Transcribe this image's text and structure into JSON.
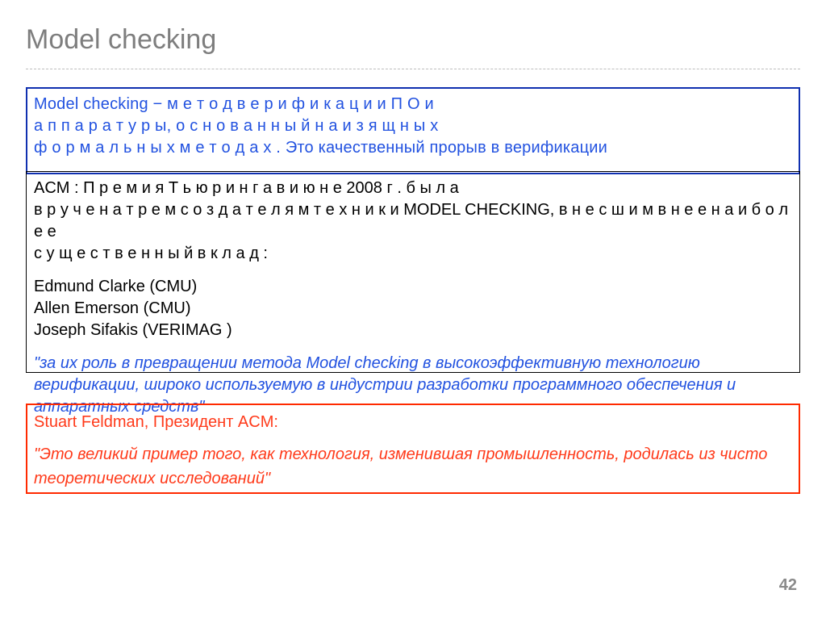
{
  "title": "Model checking",
  "blue_box": {
    "lead": "Model checking",
    "dash": " − ",
    "line1": "м е т о д  в е р и ф и к а ц и и  П О  и",
    "line2": " а п п а р а т у р ы,  о с н о в а н н ы й  н а  и з я щ н ы х",
    "line3": " ф о р м а л ь н ы х  м е т о д а х . ",
    "tail": "Это качественный прорыв в верификации"
  },
  "black_box": {
    "acm_lead": "ACM : ",
    "line1": "П р е м и я  Т ь ю р и н г а  в  и ю н е  2008  г .  б ы л а",
    "line2": " в р у ч е н а  т р е м  с о з д а т е л я м  т е х н и к и  MODEL CHECKING,  в н е с ш и м  в  н е е  н а и б о л е е",
    "line3": " с у щ е с т в е н н ы й  в к л а д :",
    "names": {
      "n1": "Edmund Clarke (CMU)",
      "n2": "Allen Emerson  (CMU)",
      "n3": "Joseph Sifakis  (VERIMAG )"
    },
    "quote": "\"за их роль в превращении метода Model checking в высокоэффективную технологию верификации, широко используемую в индустрии разработки программного обеспечения и аппаратных средств\""
  },
  "red_box": {
    "author": "Stuart Feldman, Президент ACM:",
    "quote": " \"Это великий пример того, как технология, изменившая промышленность, родилась из чисто теоретических исследований\""
  },
  "page_number": "42"
}
